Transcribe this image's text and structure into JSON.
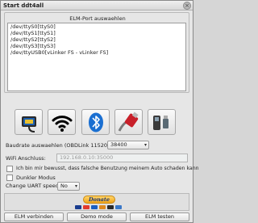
{
  "window": {
    "title": "Start ddt4all",
    "close_glyph": "×"
  },
  "port_group": {
    "title": "ELM-Port auswaehlen",
    "ports": [
      "/dev/ttyS0[ttyS0]",
      "/dev/ttyS1[ttyS1]",
      "/dev/ttyS2[ttyS2]",
      "/dev/ttyS3[ttyS3]",
      "/dev/ttyUSB0[vLinker FS - vLinker FS]"
    ]
  },
  "adapter_icons": [
    {
      "name": "obd-cable-icon"
    },
    {
      "name": "wifi-icon"
    },
    {
      "name": "bluetooth-icon"
    },
    {
      "name": "usb-cable-icon"
    },
    {
      "name": "derlei-usb-icon"
    }
  ],
  "baudrate": {
    "label": "Baudrate auswaehlen (OBDLink 115200)",
    "value": "38400"
  },
  "wifi": {
    "label": "WiFi Anschluss:",
    "placeholder": "192.168.0.10:35000"
  },
  "disclaimer": {
    "label": "Ich bin mir bewusst, dass falsche Benutzung meinem Auto schaden kann",
    "checked": false
  },
  "dark_mode": {
    "label": "Dunkler Modus",
    "checked": false
  },
  "uart": {
    "label": "Change UART speed",
    "value": "No"
  },
  "donate": {
    "label": "Donate"
  },
  "buttons": {
    "connect": "ELM verbinden",
    "demo": "Demo mode",
    "test": "ELM testen"
  },
  "colors": {
    "wifi_black": "#000000",
    "bluetooth_blue": "#1a6fd1",
    "donate_gold": "#f2a51a"
  }
}
